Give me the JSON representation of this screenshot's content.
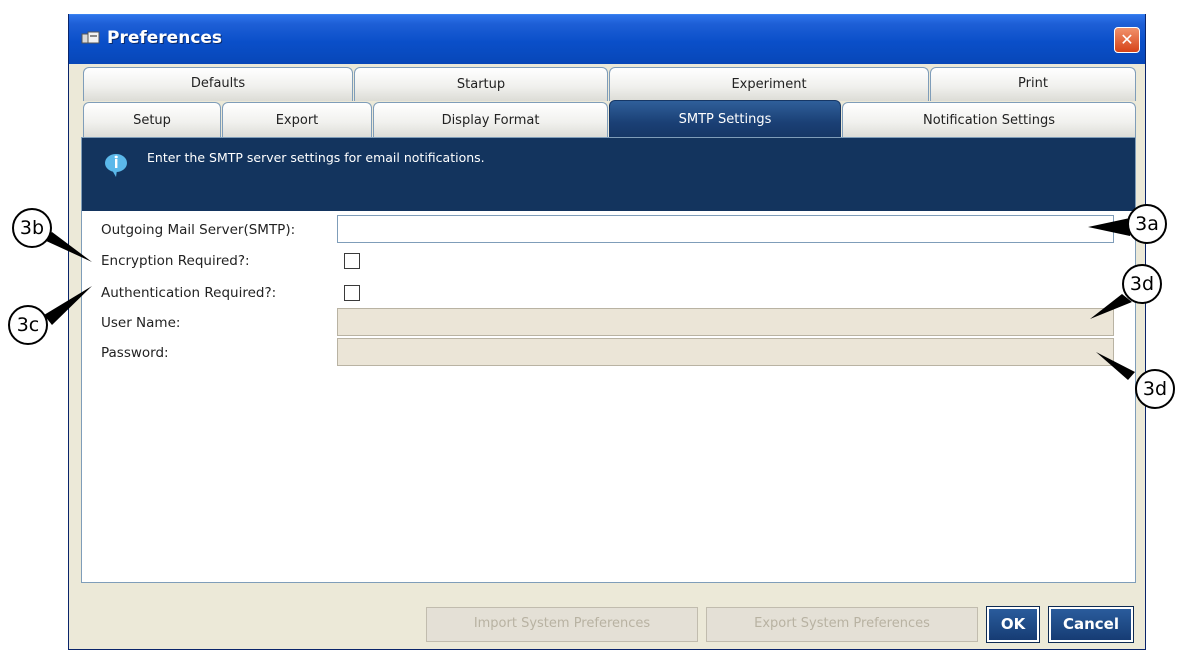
{
  "window": {
    "title": "Preferences",
    "close_glyph": "✕"
  },
  "tabs": {
    "row1": [
      "Defaults",
      "Startup",
      "Experiment",
      "Print"
    ],
    "row2": [
      "Setup",
      "Export",
      "Display Format",
      "SMTP Settings",
      "Notification Settings"
    ],
    "active": "SMTP Settings"
  },
  "banner": {
    "icon": "info-bubble-icon",
    "text": "Enter the SMTP server settings for email notifications."
  },
  "form": {
    "smtp_label": "Outgoing Mail Server(SMTP):",
    "smtp_value": "",
    "encryption_label": "Encryption Required?:",
    "encryption_checked": false,
    "authentication_label": "Authentication Required?:",
    "authentication_checked": false,
    "username_label": "User Name:",
    "username_value": "",
    "password_label": "Password:",
    "password_value": ""
  },
  "buttons": {
    "import": "Import System Preferences",
    "export": "Export System Preferences",
    "ok": "OK",
    "cancel": "Cancel"
  },
  "callouts": [
    "3a",
    "3b",
    "3c",
    "3d",
    "3d"
  ],
  "colors": {
    "titlebar": "#0a4fc9",
    "active_tab": "#1a3f74",
    "banner": "#13345e",
    "close_button": "#d64318"
  }
}
